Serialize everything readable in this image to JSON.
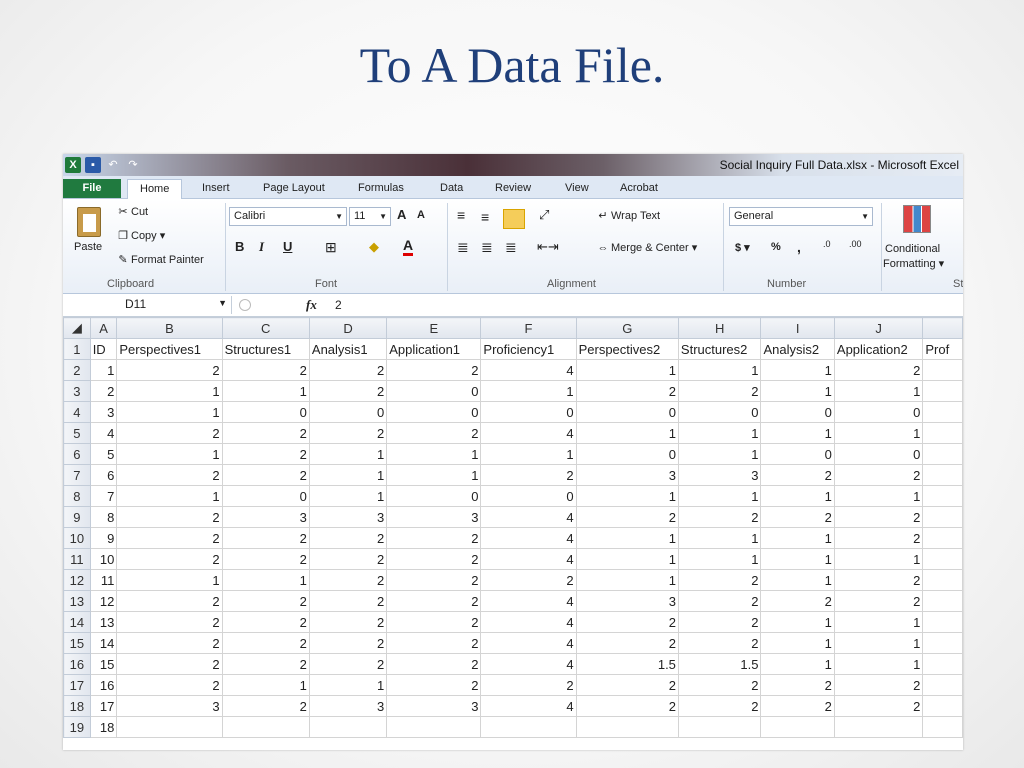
{
  "slide": {
    "title": "To A Data File."
  },
  "window": {
    "title": "Social Inquiry Full Data.xlsx  -  Microsoft Excel"
  },
  "qat": {
    "app": "X",
    "undo": "↶",
    "redo": "↷"
  },
  "tabs": [
    "File",
    "Home",
    "Insert",
    "Page Layout",
    "Formulas",
    "Data",
    "Review",
    "View",
    "Acrobat"
  ],
  "ribbon": {
    "clipboard": {
      "paste": "Paste",
      "cut": "Cut",
      "copy": "Copy ▾",
      "format_painter": "Format Painter",
      "label": "Clipboard"
    },
    "font": {
      "name": "Calibri",
      "size": "11",
      "bold": "B",
      "italic": "I",
      "underline": "U",
      "grow": "A",
      "shrink": "A",
      "label": "Font"
    },
    "alignment": {
      "wrap_text": "Wrap Text",
      "merge_center": "Merge & Center ▾",
      "label": "Alignment"
    },
    "number": {
      "format": "General",
      "currency": "$ ▾",
      "percent": "%",
      "comma": ",",
      "inc_dec": ".0",
      "dec_dec": ".00",
      "label": "Number"
    },
    "styles": {
      "conditional_formatting_1": "Conditional",
      "conditional_formatting_2": "Formatting ▾",
      "label_partial": "St"
    }
  },
  "formula_bar": {
    "name_box": "D11",
    "fx": "fx",
    "value": "2"
  },
  "grid": {
    "columns": [
      "A",
      "B",
      "C",
      "D",
      "E",
      "F",
      "G",
      "H",
      "I",
      "J",
      ""
    ],
    "headers": [
      "ID",
      "Perspectives1",
      "Structures1",
      "Analysis1",
      "Application1",
      "Proficiency1",
      "Perspectives2",
      "Structures2",
      "Analysis2",
      "Application2",
      "Prof"
    ],
    "rows": [
      [
        "1",
        "2",
        "2",
        "2",
        "2",
        "4",
        "1",
        "1",
        "1",
        "2",
        ""
      ],
      [
        "2",
        "1",
        "1",
        "2",
        "0",
        "1",
        "2",
        "2",
        "1",
        "1",
        ""
      ],
      [
        "3",
        "1",
        "0",
        "0",
        "0",
        "0",
        "0",
        "0",
        "0",
        "0",
        ""
      ],
      [
        "4",
        "2",
        "2",
        "2",
        "2",
        "4",
        "1",
        "1",
        "1",
        "1",
        ""
      ],
      [
        "5",
        "1",
        "2",
        "1",
        "1",
        "1",
        "0",
        "1",
        "0",
        "0",
        ""
      ],
      [
        "6",
        "2",
        "2",
        "1",
        "1",
        "2",
        "3",
        "3",
        "2",
        "2",
        ""
      ],
      [
        "7",
        "1",
        "0",
        "1",
        "0",
        "0",
        "1",
        "1",
        "1",
        "1",
        ""
      ],
      [
        "8",
        "2",
        "3",
        "3",
        "3",
        "4",
        "2",
        "2",
        "2",
        "2",
        ""
      ],
      [
        "9",
        "2",
        "2",
        "2",
        "2",
        "4",
        "1",
        "1",
        "1",
        "2",
        ""
      ],
      [
        "10",
        "2",
        "2",
        "2",
        "2",
        "4",
        "1",
        "1",
        "1",
        "1",
        ""
      ],
      [
        "11",
        "1",
        "1",
        "2",
        "2",
        "2",
        "1",
        "2",
        "1",
        "2",
        ""
      ],
      [
        "12",
        "2",
        "2",
        "2",
        "2",
        "4",
        "3",
        "2",
        "2",
        "2",
        ""
      ],
      [
        "13",
        "2",
        "2",
        "2",
        "2",
        "4",
        "2",
        "2",
        "1",
        "1",
        ""
      ],
      [
        "14",
        "2",
        "2",
        "2",
        "2",
        "4",
        "2",
        "2",
        "1",
        "1",
        ""
      ],
      [
        "15",
        "2",
        "2",
        "2",
        "2",
        "4",
        "1.5",
        "1.5",
        "1",
        "1",
        ""
      ],
      [
        "16",
        "2",
        "1",
        "1",
        "2",
        "2",
        "2",
        "2",
        "2",
        "2",
        ""
      ],
      [
        "17",
        "3",
        "2",
        "3",
        "3",
        "4",
        "2",
        "2",
        "2",
        "2",
        ""
      ],
      [
        "18",
        "",
        "",
        "",
        "",
        "",
        "",
        "",
        "",
        "",
        ""
      ]
    ]
  }
}
